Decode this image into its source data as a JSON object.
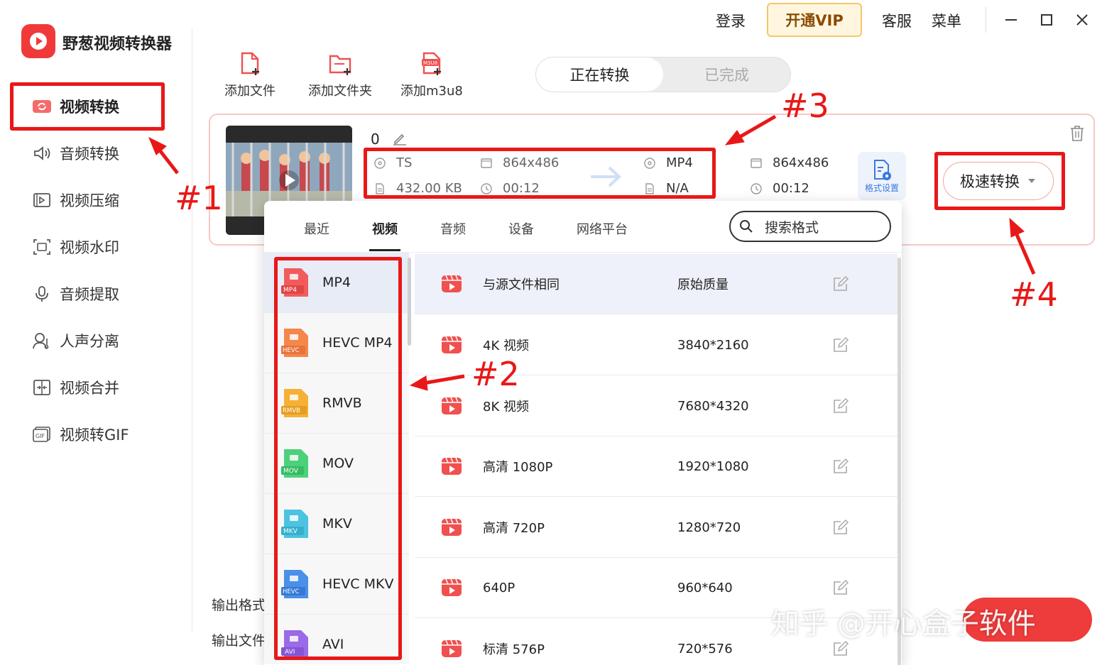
{
  "app": {
    "title": "野葱视频转换器"
  },
  "topbar": {
    "login": "登录",
    "vip": "开通VIP",
    "service": "客服",
    "menu": "菜单"
  },
  "sidebar": {
    "items": [
      {
        "label": "视频转换"
      },
      {
        "label": "音频转换"
      },
      {
        "label": "视频压缩"
      },
      {
        "label": "视频水印"
      },
      {
        "label": "音频提取"
      },
      {
        "label": "人声分离"
      },
      {
        "label": "视频合并"
      },
      {
        "label": "视频转GIF"
      }
    ]
  },
  "toolbar": {
    "add_file": "添加文件",
    "add_folder": "添加文件夹",
    "add_m3u8": "添加m3u8",
    "m3u8_badge": "M3U8"
  },
  "tabs": {
    "converting": "正在转换",
    "done": "已完成"
  },
  "file": {
    "name": "0",
    "src_format": "TS",
    "src_resolution": "864x486",
    "src_size": "432.00 KB",
    "src_duration": "00:12",
    "dst_format": "MP4",
    "dst_size": "N/A",
    "out_resolution": "864x486",
    "out_duration": "00:12",
    "format_settings": "格式设置",
    "convert_button": "极速转换"
  },
  "output": {
    "format_label": "输出格式",
    "folder_label": "输出文件"
  },
  "format_panel": {
    "tabs": [
      "最近",
      "视频",
      "音频",
      "设备",
      "网络平台"
    ],
    "search_placeholder": "搜索格式",
    "formats": [
      {
        "name": "MP4",
        "badge": "MP4",
        "color": "#f25b5b"
      },
      {
        "name": "HEVC MP4",
        "badge": "HEVC",
        "color": "#f4874a"
      },
      {
        "name": "RMVB",
        "badge": "RMVB",
        "color": "#f5b035"
      },
      {
        "name": "MOV",
        "badge": "MOV",
        "color": "#4cd17a"
      },
      {
        "name": "MKV",
        "badge": "MKV",
        "color": "#4cc3e0"
      },
      {
        "name": "HEVC MKV",
        "badge": "HEVC",
        "color": "#4a8fe8"
      },
      {
        "name": "AVI",
        "badge": "AVI",
        "color": "#9a6ae8"
      }
    ],
    "options": [
      {
        "name": "与源文件相同",
        "quality": "原始质量"
      },
      {
        "name": "4K 视频",
        "quality": "3840*2160"
      },
      {
        "name": "8K 视频",
        "quality": "7680*4320"
      },
      {
        "name": "高清 1080P",
        "quality": "1920*1080"
      },
      {
        "name": "高清 720P",
        "quality": "1280*720"
      },
      {
        "name": "640P",
        "quality": "960*640"
      },
      {
        "name": "标清 576P",
        "quality": "720*576"
      }
    ]
  },
  "annotations": {
    "m1": "#1",
    "m2": "#2",
    "m3": "#3",
    "m4": "#4"
  },
  "watermark": "知乎 @开心盒子软件"
}
